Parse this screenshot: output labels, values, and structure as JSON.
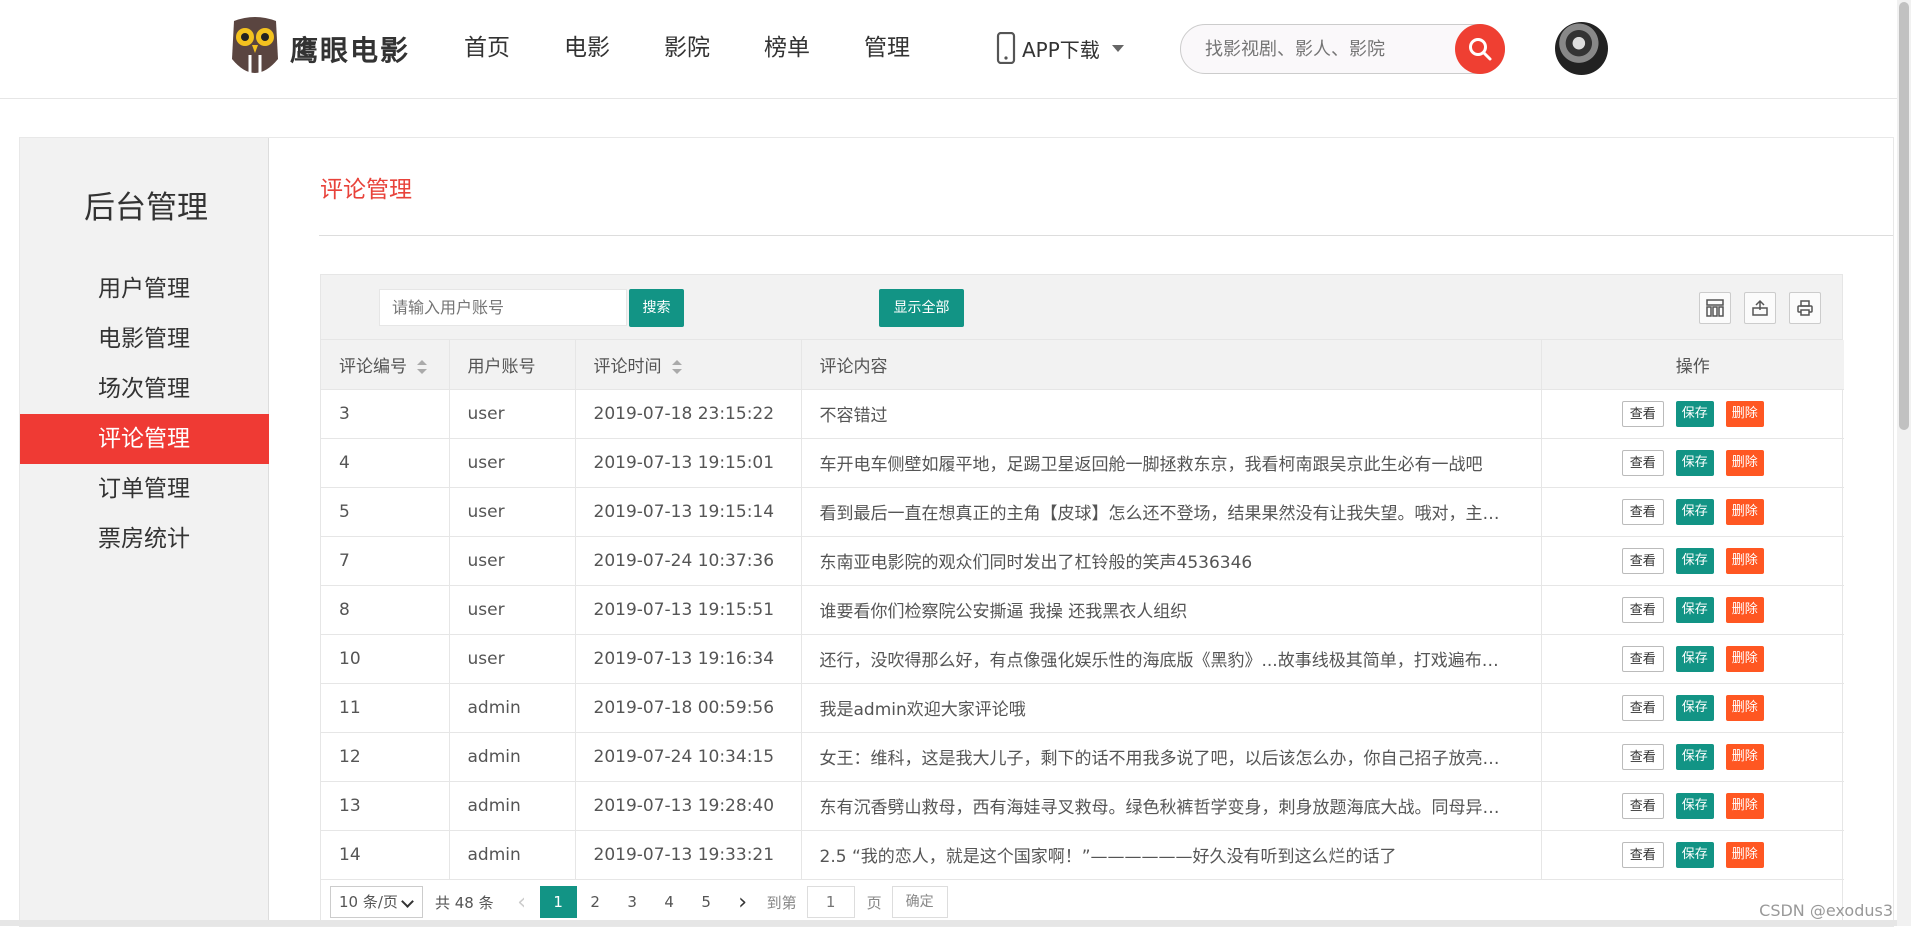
{
  "header": {
    "logo_text": "鹰眼电影",
    "nav": [
      "首页",
      "电影",
      "影院",
      "榜单",
      "管理"
    ],
    "app_download": "APP下载",
    "search_placeholder": "找影视剧、影人、影院"
  },
  "sidebar": {
    "title": "后台管理",
    "items": [
      "用户管理",
      "电影管理",
      "场次管理",
      "评论管理",
      "订单管理",
      "票房统计"
    ],
    "active_index": 3
  },
  "main": {
    "title": "评论管理",
    "search_placeholder": "请输入用户账号",
    "search_button": "搜索",
    "show_all_button": "显示全部",
    "columns": [
      "评论编号",
      "用户账号",
      "评论时间",
      "评论内容",
      "操作"
    ],
    "rows": [
      {
        "id": "3",
        "user": "user",
        "time": "2019-07-18 23:15:22",
        "content": "不容错过"
      },
      {
        "id": "4",
        "user": "user",
        "time": "2019-07-13 19:15:01",
        "content": "车开电车侧壁如履平地，足踢卫星返回舱一脚拯救东京，我看柯南跟吴京此生必有一战吧"
      },
      {
        "id": "5",
        "user": "user",
        "time": "2019-07-13 19:15:14",
        "content": "看到最后一直在想真正的主角【皮球】怎么还不登场，结果果然没有让我失望。哦对，主…"
      },
      {
        "id": "7",
        "user": "user",
        "time": "2019-07-24 10:37:36",
        "content": "东南亚电影院的观众们同时发出了杠铃般的笑声4536346"
      },
      {
        "id": "8",
        "user": "user",
        "time": "2019-07-13 19:15:51",
        "content": "谁要看你们检察院公安撕逼 我操 还我黑衣人组织"
      },
      {
        "id": "10",
        "user": "user",
        "time": "2019-07-13 19:16:34",
        "content": "还行，没吹得那么好，有点像强化娱乐性的海底版《黑豹》...故事线极其简单，打戏遍布…"
      },
      {
        "id": "11",
        "user": "admin",
        "time": "2019-07-18 00:59:56",
        "content": "我是admin欢迎大家评论哦"
      },
      {
        "id": "12",
        "user": "admin",
        "time": "2019-07-24 10:34:15",
        "content": "女王：维科，这是我大儿子，剩下的话不用我多说了吧，以后该怎么办，你自己招子放亮…"
      },
      {
        "id": "13",
        "user": "admin",
        "time": "2019-07-13 19:28:40",
        "content": "东有沉香劈山救母，西有海娃寻叉救母。绿色秋裤哲学变身，刺身放题海底大战。同母异…"
      },
      {
        "id": "14",
        "user": "admin",
        "time": "2019-07-13 19:33:21",
        "content": "2.5 “我的恋人，就是这个国家啊！”——————好久没有听到这么烂的话了"
      }
    ],
    "op_labels": {
      "view": "查看",
      "save": "保存",
      "delete": "删除"
    },
    "pager": {
      "page_size": "10 条/页",
      "total": "共 48 条",
      "pages": [
        "1",
        "2",
        "3",
        "4",
        "5"
      ],
      "current": "1",
      "goto_label": "到第",
      "goto_value": "1",
      "unit": "页",
      "confirm": "确定"
    }
  },
  "watermark": "CSDN @exodus3",
  "colors": {
    "brand_red": "#ef3a34",
    "teal": "#129485",
    "delete_orange": "#ff5722"
  }
}
